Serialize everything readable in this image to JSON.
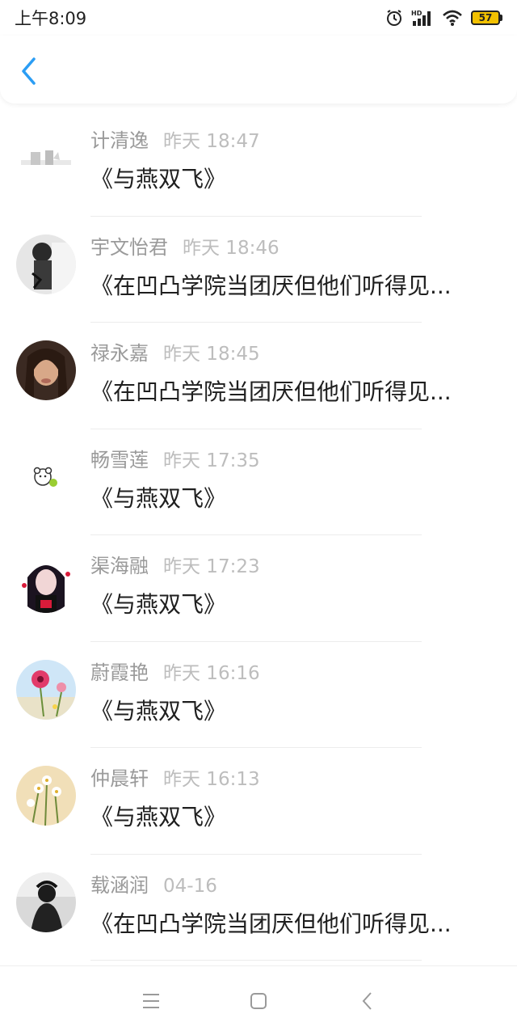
{
  "status_bar": {
    "time": "上午8:09",
    "battery": "57",
    "hd_label": "HD",
    "icons": [
      "alarm-icon",
      "signal-icon",
      "wifi-icon",
      "battery-icon"
    ]
  },
  "header": {
    "back_icon": "chevron-left-icon",
    "accent_color": "#2b9df4"
  },
  "messages": [
    {
      "name": "计清逸",
      "time": "昨天 18:47",
      "text": "《与燕双飞》"
    },
    {
      "name": "宇文怡君",
      "time": "昨天 18:46",
      "text": "《在凹凸学院当团厌但他们听得见..."
    },
    {
      "name": "禄永嘉",
      "time": "昨天 18:45",
      "text": "《在凹凸学院当团厌但他们听得见..."
    },
    {
      "name": "畅雪莲",
      "time": "昨天 17:35",
      "text": "《与燕双飞》"
    },
    {
      "name": "渠海融",
      "time": "昨天 17:23",
      "text": "《与燕双飞》"
    },
    {
      "name": "蔚霞艳",
      "time": "昨天 16:16",
      "text": "《与燕双飞》"
    },
    {
      "name": "仲晨轩",
      "time": "昨天 16:13",
      "text": "《与燕双飞》"
    },
    {
      "name": "载涵润",
      "time": "04-16",
      "text": "《在凹凸学院当团厌但他们听得见..."
    }
  ],
  "nav_bar": {
    "icons": [
      "menu-icon",
      "home-square-icon",
      "back-triangle-icon"
    ]
  }
}
